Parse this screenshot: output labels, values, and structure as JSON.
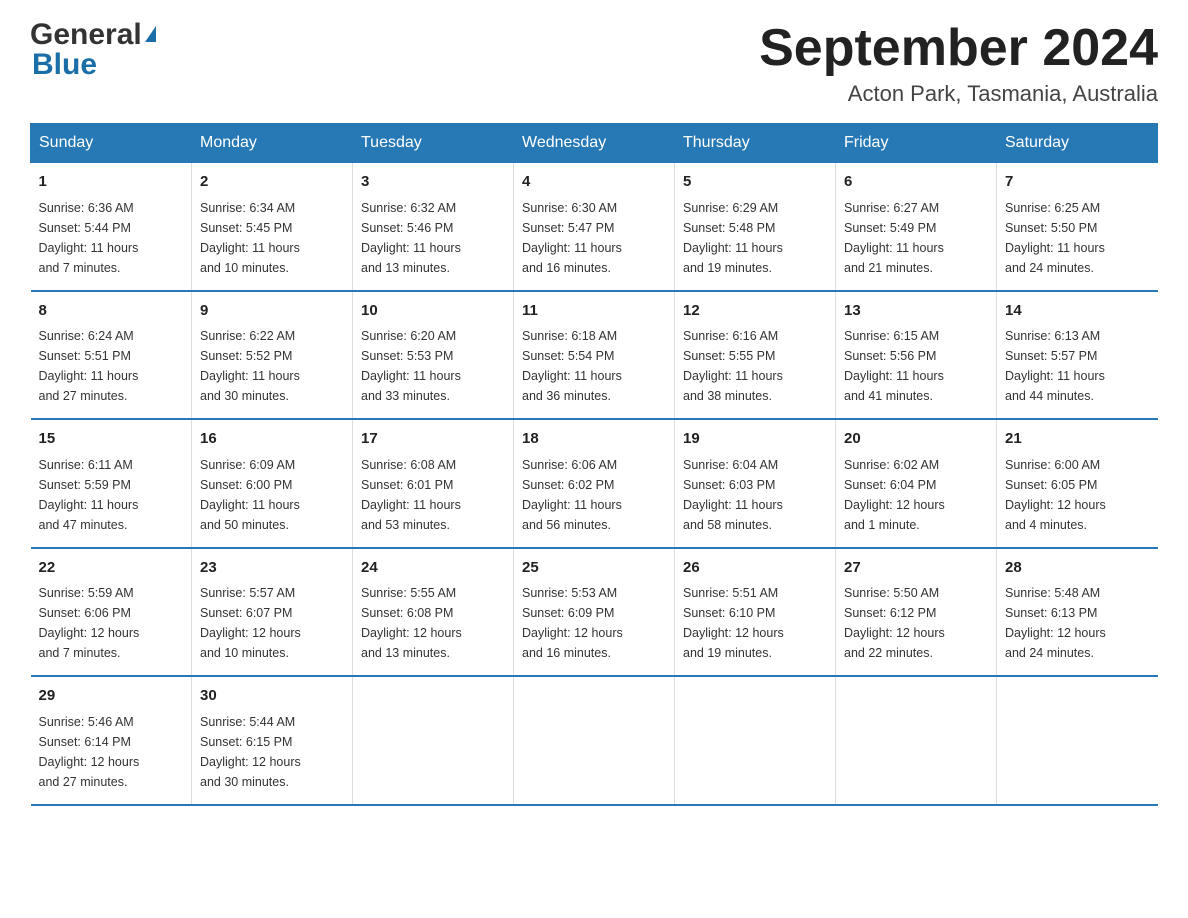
{
  "header": {
    "logo_general": "General",
    "logo_blue": "Blue",
    "month_title": "September 2024",
    "location": "Acton Park, Tasmania, Australia"
  },
  "days_of_week": [
    "Sunday",
    "Monday",
    "Tuesday",
    "Wednesday",
    "Thursday",
    "Friday",
    "Saturday"
  ],
  "weeks": [
    [
      {
        "day": "1",
        "sunrise": "6:36 AM",
        "sunset": "5:44 PM",
        "daylight": "11 hours and 7 minutes."
      },
      {
        "day": "2",
        "sunrise": "6:34 AM",
        "sunset": "5:45 PM",
        "daylight": "11 hours and 10 minutes."
      },
      {
        "day": "3",
        "sunrise": "6:32 AM",
        "sunset": "5:46 PM",
        "daylight": "11 hours and 13 minutes."
      },
      {
        "day": "4",
        "sunrise": "6:30 AM",
        "sunset": "5:47 PM",
        "daylight": "11 hours and 16 minutes."
      },
      {
        "day": "5",
        "sunrise": "6:29 AM",
        "sunset": "5:48 PM",
        "daylight": "11 hours and 19 minutes."
      },
      {
        "day": "6",
        "sunrise": "6:27 AM",
        "sunset": "5:49 PM",
        "daylight": "11 hours and 21 minutes."
      },
      {
        "day": "7",
        "sunrise": "6:25 AM",
        "sunset": "5:50 PM",
        "daylight": "11 hours and 24 minutes."
      }
    ],
    [
      {
        "day": "8",
        "sunrise": "6:24 AM",
        "sunset": "5:51 PM",
        "daylight": "11 hours and 27 minutes."
      },
      {
        "day": "9",
        "sunrise": "6:22 AM",
        "sunset": "5:52 PM",
        "daylight": "11 hours and 30 minutes."
      },
      {
        "day": "10",
        "sunrise": "6:20 AM",
        "sunset": "5:53 PM",
        "daylight": "11 hours and 33 minutes."
      },
      {
        "day": "11",
        "sunrise": "6:18 AM",
        "sunset": "5:54 PM",
        "daylight": "11 hours and 36 minutes."
      },
      {
        "day": "12",
        "sunrise": "6:16 AM",
        "sunset": "5:55 PM",
        "daylight": "11 hours and 38 minutes."
      },
      {
        "day": "13",
        "sunrise": "6:15 AM",
        "sunset": "5:56 PM",
        "daylight": "11 hours and 41 minutes."
      },
      {
        "day": "14",
        "sunrise": "6:13 AM",
        "sunset": "5:57 PM",
        "daylight": "11 hours and 44 minutes."
      }
    ],
    [
      {
        "day": "15",
        "sunrise": "6:11 AM",
        "sunset": "5:59 PM",
        "daylight": "11 hours and 47 minutes."
      },
      {
        "day": "16",
        "sunrise": "6:09 AM",
        "sunset": "6:00 PM",
        "daylight": "11 hours and 50 minutes."
      },
      {
        "day": "17",
        "sunrise": "6:08 AM",
        "sunset": "6:01 PM",
        "daylight": "11 hours and 53 minutes."
      },
      {
        "day": "18",
        "sunrise": "6:06 AM",
        "sunset": "6:02 PM",
        "daylight": "11 hours and 56 minutes."
      },
      {
        "day": "19",
        "sunrise": "6:04 AM",
        "sunset": "6:03 PM",
        "daylight": "11 hours and 58 minutes."
      },
      {
        "day": "20",
        "sunrise": "6:02 AM",
        "sunset": "6:04 PM",
        "daylight": "12 hours and 1 minute."
      },
      {
        "day": "21",
        "sunrise": "6:00 AM",
        "sunset": "6:05 PM",
        "daylight": "12 hours and 4 minutes."
      }
    ],
    [
      {
        "day": "22",
        "sunrise": "5:59 AM",
        "sunset": "6:06 PM",
        "daylight": "12 hours and 7 minutes."
      },
      {
        "day": "23",
        "sunrise": "5:57 AM",
        "sunset": "6:07 PM",
        "daylight": "12 hours and 10 minutes."
      },
      {
        "day": "24",
        "sunrise": "5:55 AM",
        "sunset": "6:08 PM",
        "daylight": "12 hours and 13 minutes."
      },
      {
        "day": "25",
        "sunrise": "5:53 AM",
        "sunset": "6:09 PM",
        "daylight": "12 hours and 16 minutes."
      },
      {
        "day": "26",
        "sunrise": "5:51 AM",
        "sunset": "6:10 PM",
        "daylight": "12 hours and 19 minutes."
      },
      {
        "day": "27",
        "sunrise": "5:50 AM",
        "sunset": "6:12 PM",
        "daylight": "12 hours and 22 minutes."
      },
      {
        "day": "28",
        "sunrise": "5:48 AM",
        "sunset": "6:13 PM",
        "daylight": "12 hours and 24 minutes."
      }
    ],
    [
      {
        "day": "29",
        "sunrise": "5:46 AM",
        "sunset": "6:14 PM",
        "daylight": "12 hours and 27 minutes."
      },
      {
        "day": "30",
        "sunrise": "5:44 AM",
        "sunset": "6:15 PM",
        "daylight": "12 hours and 30 minutes."
      },
      {
        "day": "",
        "sunrise": "",
        "sunset": "",
        "daylight": ""
      },
      {
        "day": "",
        "sunrise": "",
        "sunset": "",
        "daylight": ""
      },
      {
        "day": "",
        "sunrise": "",
        "sunset": "",
        "daylight": ""
      },
      {
        "day": "",
        "sunrise": "",
        "sunset": "",
        "daylight": ""
      },
      {
        "day": "",
        "sunrise": "",
        "sunset": "",
        "daylight": ""
      }
    ]
  ],
  "labels": {
    "sunrise": "Sunrise:",
    "sunset": "Sunset:",
    "daylight": "Daylight:"
  }
}
